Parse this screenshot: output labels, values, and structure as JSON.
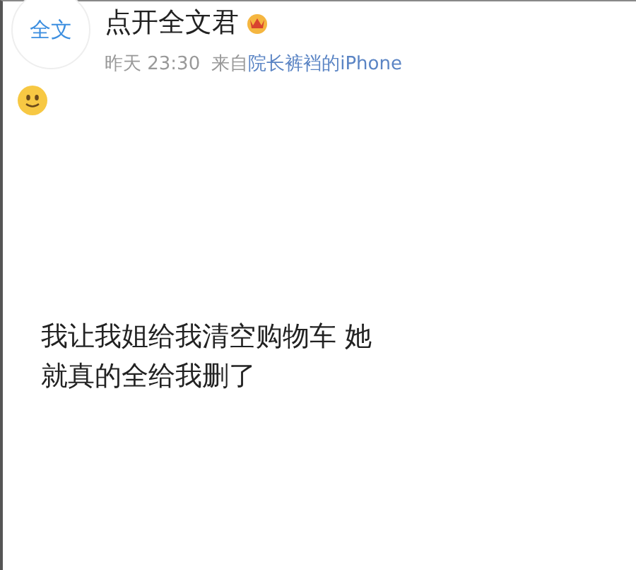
{
  "post": {
    "avatar_text": "全文",
    "author": "点开全文君",
    "time": "昨天 23:30",
    "source_prefix": "来自",
    "source": "院长裤裆的iPhone",
    "text": "我让我姐给我清空购物车 她就真的全给我删了"
  }
}
